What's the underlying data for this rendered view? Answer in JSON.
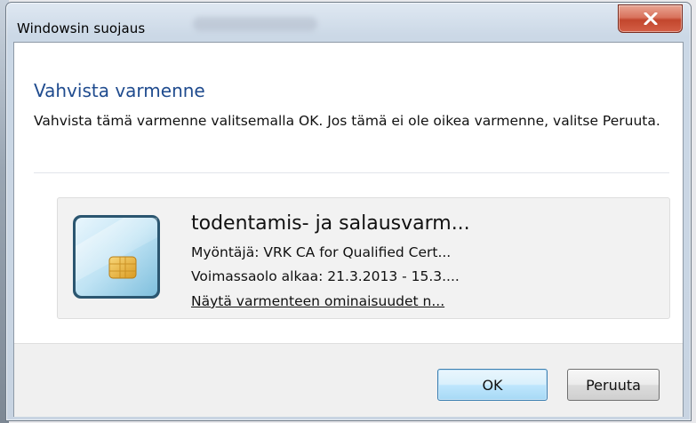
{
  "window": {
    "title": "Windowsin suojaus",
    "close_symbol": "X"
  },
  "dialog": {
    "heading": "Vahvista varmenne",
    "description": "Vahvista tämä varmenne valitsemalla OK. Jos tämä ei ole oikea varmenne, valitse Peruuta."
  },
  "certificate": {
    "icon": "smart-card-icon",
    "name": "todentamis- ja salausvarm...",
    "issuer": "Myöntäjä: VRK CA for Qualified Cert...",
    "validity": "Voimassaolo alkaa: 21.3.2013 - 15.3....",
    "properties_link": "Näytä varmenteen ominaisuudet n..."
  },
  "buttons": {
    "ok": "OK",
    "cancel": "Peruuta"
  },
  "colors": {
    "heading": "#1f4b8e",
    "close_button": "#c2462d",
    "ok_button_border": "#3c7fb1"
  }
}
